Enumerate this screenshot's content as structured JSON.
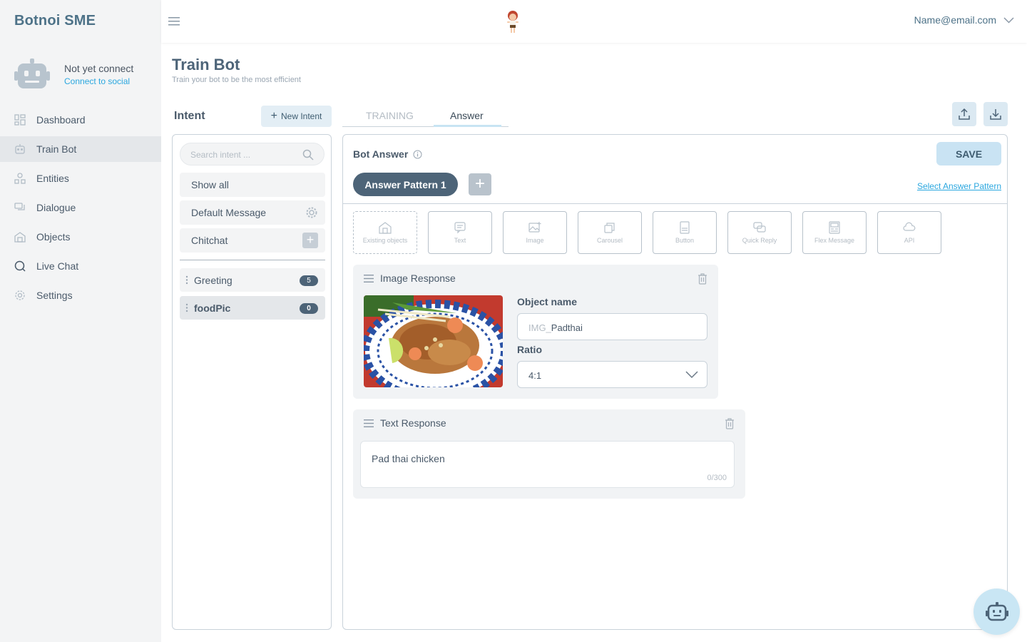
{
  "app": {
    "brand": "Botnoi SME"
  },
  "connection": {
    "status": "Not yet connect",
    "link": "Connect to social"
  },
  "nav": [
    {
      "label": "Dashboard",
      "icon": "dashboard-icon"
    },
    {
      "label": "Train Bot",
      "icon": "robot-icon",
      "active": true
    },
    {
      "label": "Entities",
      "icon": "entities-icon"
    },
    {
      "label": "Dialogue",
      "icon": "dialogue-icon"
    },
    {
      "label": "Objects",
      "icon": "objects-icon"
    },
    {
      "label": "Live Chat",
      "icon": "live-chat-icon"
    },
    {
      "label": "Settings",
      "icon": "gear-icon"
    }
  ],
  "header": {
    "user_email": "Name@email.com"
  },
  "page": {
    "title": "Train Bot",
    "subtitle": "Train your bot to be the most efficient"
  },
  "intent": {
    "heading": "Intent",
    "new_button": "New Intent",
    "search_placeholder": "Search intent ...",
    "fixed": [
      "Show all",
      "Default Message",
      "Chitchat"
    ],
    "items": [
      {
        "name": "Greeting",
        "count": "5"
      },
      {
        "name": "foodPic",
        "count": "0",
        "selected": true
      }
    ]
  },
  "tabs": {
    "training": "TRAINING",
    "answer": "Answer",
    "active": "Answer"
  },
  "answer": {
    "heading": "Bot Answer",
    "save": "SAVE",
    "pattern": "Answer Pattern 1",
    "select_pattern": "Select Answer Pattern",
    "tools": [
      "Existing objects",
      "Text",
      "Image",
      "Carousel",
      "Button",
      "Quick Reply",
      "Flex Message",
      "API"
    ],
    "image_card": {
      "title": "Image Response",
      "object_name_label": "Object name",
      "object_prefix": "IMG_",
      "object_value": "Padthai",
      "ratio_label": "Ratio",
      "ratio_value": "4:1"
    },
    "text_card": {
      "title": "Text Response",
      "text": "Pad thai chicken",
      "counter": "0/300"
    }
  },
  "colors": {
    "brand": "#4d7288",
    "accent": "#2ba7df",
    "pill": "#4d6478",
    "save_bg": "#c9e3f3"
  }
}
